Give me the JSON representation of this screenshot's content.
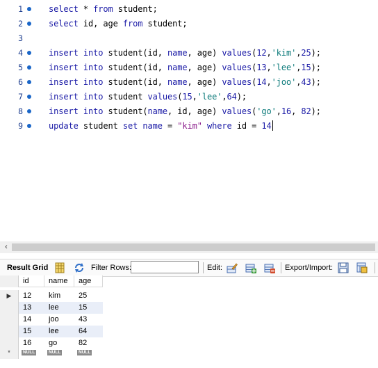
{
  "editor": {
    "lines": [
      {
        "no": "1",
        "has_dot": true,
        "tokens": [
          [
            "kw",
            "select"
          ],
          [
            "",
            "* "
          ],
          [
            "kw",
            "from"
          ],
          [
            "",
            "",
            " student;"
          ]
        ]
      },
      {
        "no": "2",
        "has_dot": true,
        "tokens": []
      },
      {
        "no": "3",
        "has_dot": false,
        "tokens": []
      },
      {
        "no": "4",
        "has_dot": true,
        "tokens": []
      },
      {
        "no": "5",
        "has_dot": true,
        "tokens": []
      },
      {
        "no": "6",
        "has_dot": true,
        "tokens": []
      },
      {
        "no": "7",
        "has_dot": true,
        "tokens": []
      },
      {
        "no": "8",
        "has_dot": true,
        "tokens": []
      },
      {
        "no": "9",
        "has_dot": true,
        "tokens": []
      }
    ],
    "code": [
      [
        [
          "kw",
          "select"
        ],
        [
          "t",
          " * "
        ],
        [
          "kw",
          "from"
        ],
        [
          "t",
          " student;"
        ]
      ],
      [
        [
          "kw",
          "select"
        ],
        [
          "t",
          " id, age "
        ],
        [
          "kw",
          "from"
        ],
        [
          "t",
          " student;"
        ]
      ],
      [],
      [
        [
          "kw",
          "insert into"
        ],
        [
          "t",
          " student(id, "
        ],
        [
          "kw",
          "name"
        ],
        [
          "t",
          ", age) "
        ],
        [
          "kw",
          "values"
        ],
        [
          "t",
          "("
        ],
        [
          "num",
          "12"
        ],
        [
          "t",
          ","
        ],
        [
          "str",
          "'kim'"
        ],
        [
          "t",
          ","
        ],
        [
          "num",
          "25"
        ],
        [
          "t",
          ");"
        ]
      ],
      [
        [
          "kw",
          "insert into"
        ],
        [
          "t",
          " student(id, "
        ],
        [
          "kw",
          "name"
        ],
        [
          "t",
          ", age) "
        ],
        [
          "kw",
          "values"
        ],
        [
          "t",
          "("
        ],
        [
          "num",
          "13"
        ],
        [
          "t",
          ","
        ],
        [
          "str",
          "'lee'"
        ],
        [
          "t",
          ","
        ],
        [
          "num",
          "15"
        ],
        [
          "t",
          ");"
        ]
      ],
      [
        [
          "kw",
          "insert into"
        ],
        [
          "t",
          " student(id, "
        ],
        [
          "kw",
          "name"
        ],
        [
          "t",
          ", age) "
        ],
        [
          "kw",
          "values"
        ],
        [
          "t",
          "("
        ],
        [
          "num",
          "14"
        ],
        [
          "t",
          ","
        ],
        [
          "str",
          "'joo'"
        ],
        [
          "t",
          ","
        ],
        [
          "num",
          "43"
        ],
        [
          "t",
          ");"
        ]
      ],
      [
        [
          "kw",
          "insert into"
        ],
        [
          "t",
          " student "
        ],
        [
          "kw",
          "values"
        ],
        [
          "t",
          "("
        ],
        [
          "num",
          "15"
        ],
        [
          "t",
          ","
        ],
        [
          "str",
          "'lee'"
        ],
        [
          "t",
          ","
        ],
        [
          "num",
          "64"
        ],
        [
          "t",
          ");"
        ]
      ],
      [
        [
          "kw",
          "insert into"
        ],
        [
          "t",
          " student("
        ],
        [
          "kw",
          "name"
        ],
        [
          "t",
          ", id, age) "
        ],
        [
          "kw",
          "values"
        ],
        [
          "t",
          "("
        ],
        [
          "str",
          "'go'"
        ],
        [
          "t",
          ","
        ],
        [
          "num",
          "16"
        ],
        [
          "t",
          ", "
        ],
        [
          "num",
          "82"
        ],
        [
          "t",
          ");"
        ]
      ],
      [
        [
          "kw",
          "update"
        ],
        [
          "t",
          " student "
        ],
        [
          "kw",
          "set"
        ],
        [
          "t",
          " "
        ],
        [
          "kw",
          "name"
        ],
        [
          "t",
          " = "
        ],
        [
          "dq",
          "\"kim\""
        ],
        [
          "t",
          " "
        ],
        [
          "kw",
          "where"
        ],
        [
          "t",
          " id = "
        ],
        [
          "num",
          "14"
        ]
      ]
    ]
  },
  "toolbar": {
    "result_grid_label": "Result Grid",
    "filter_rows_label": "Filter Rows:",
    "filter_value": "",
    "edit_label": "Edit:",
    "export_import_label": "Export/Import:"
  },
  "grid": {
    "columns": [
      "id",
      "name",
      "age"
    ],
    "rows": [
      [
        "12",
        "kim",
        "25"
      ],
      [
        "13",
        "lee",
        "15"
      ],
      [
        "14",
        "joo",
        "43"
      ],
      [
        "15",
        "lee",
        "64"
      ],
      [
        "16",
        "go",
        "82"
      ]
    ],
    "null_label": "NULL",
    "new_row_marker": "*",
    "current_row_marker": "▶"
  },
  "colors": {
    "keyword": "#1a1aa6",
    "string": "#0b7a7a",
    "selected_row": "#e9eef8"
  }
}
